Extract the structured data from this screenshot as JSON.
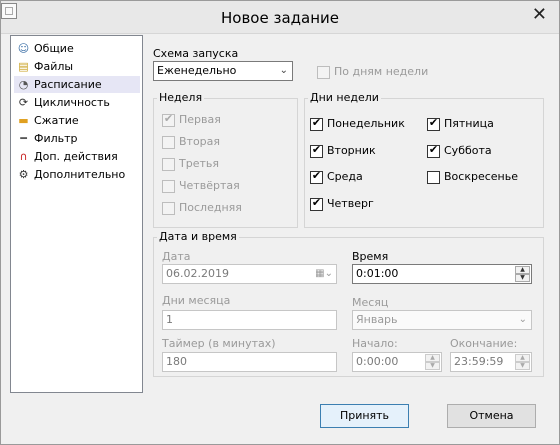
{
  "window": {
    "title": "Новое задание"
  },
  "nav": {
    "items": [
      {
        "label": "Общие",
        "icon": "user-icon",
        "glyph": "☺",
        "color": "#3a6ea5"
      },
      {
        "label": "Файлы",
        "icon": "files-icon",
        "glyph": "▤",
        "color": "#c8a020"
      },
      {
        "label": "Расписание",
        "icon": "schedule-icon",
        "glyph": "◔",
        "color": "#555555"
      },
      {
        "label": "Цикличность",
        "icon": "cycle-icon",
        "glyph": "⟳",
        "color": "#333333"
      },
      {
        "label": "Сжатие",
        "icon": "compress-icon",
        "glyph": "▬",
        "color": "#e0a020"
      },
      {
        "label": "Фильтр",
        "icon": "filter-icon",
        "glyph": "━",
        "color": "#555555"
      },
      {
        "label": "Доп. действия",
        "icon": "magnet-icon",
        "glyph": "∩",
        "color": "#c82020"
      },
      {
        "label": "Дополнительно",
        "icon": "gear-icon",
        "glyph": "⚙",
        "color": "#333333"
      }
    ],
    "selected_index": 2
  },
  "schedule": {
    "label": "Схема запуска",
    "value": "Еженедельно",
    "by_weekdays_label": "По дням недели"
  },
  "week": {
    "title": "Неделя",
    "items": [
      {
        "label": "Первая",
        "checked": true
      },
      {
        "label": "Вторая",
        "checked": false
      },
      {
        "label": "Третья",
        "checked": false
      },
      {
        "label": "Четвёртая",
        "checked": false
      },
      {
        "label": "Последняя",
        "checked": false
      }
    ]
  },
  "weekdays": {
    "title": "Дни недели",
    "items": [
      {
        "label": "Понедельник",
        "checked": true
      },
      {
        "label": "Вторник",
        "checked": true
      },
      {
        "label": "Среда",
        "checked": true
      },
      {
        "label": "Четверг",
        "checked": true
      },
      {
        "label": "Пятница",
        "checked": true
      },
      {
        "label": "Суббота",
        "checked": true
      },
      {
        "label": "Воскресенье",
        "checked": false
      }
    ]
  },
  "datetime": {
    "title": "Дата и время",
    "date_label": "Дата",
    "date_value": "06.02.2019",
    "time_label": "Время",
    "time_value": "0:01:00",
    "days_label": "Дни месяца",
    "days_value": "1",
    "month_label": "Месяц",
    "month_value": "Январь",
    "timer_label": "Таймер (в минутах)",
    "timer_value": "180",
    "start_label": "Начало:",
    "start_value": "0:00:00",
    "end_label": "Окончание:",
    "end_value": "23:59:59"
  },
  "buttons": {
    "ok": "Принять",
    "cancel": "Отмена"
  }
}
